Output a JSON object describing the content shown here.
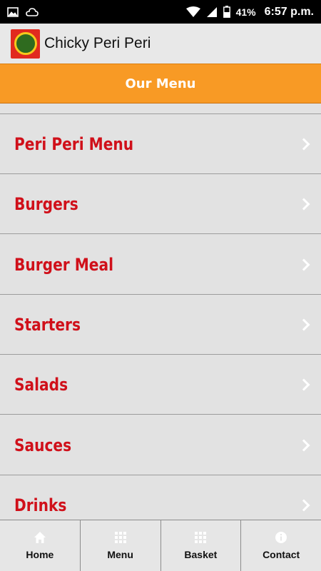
{
  "status_bar": {
    "battery_pct": "41%",
    "time": "6:57 p.m."
  },
  "app": {
    "title": "Chicky Peri Peri"
  },
  "header": {
    "title": "Our Menu"
  },
  "menu": {
    "items": [
      {
        "label": "Peri Peri Menu"
      },
      {
        "label": "Burgers"
      },
      {
        "label": "Burger Meal"
      },
      {
        "label": "Starters"
      },
      {
        "label": "Salads"
      },
      {
        "label": "Sauces"
      },
      {
        "label": "Drinks"
      }
    ]
  },
  "bottom_nav": {
    "items": [
      {
        "label": "Home",
        "icon": "home-icon"
      },
      {
        "label": "Menu",
        "icon": "grid-icon"
      },
      {
        "label": "Basket",
        "icon": "grid-icon"
      },
      {
        "label": "Contact",
        "icon": "info-icon"
      }
    ]
  },
  "colors": {
    "accent": "#f89a25",
    "item_text": "#d0101a",
    "status_bar": "#000000"
  }
}
